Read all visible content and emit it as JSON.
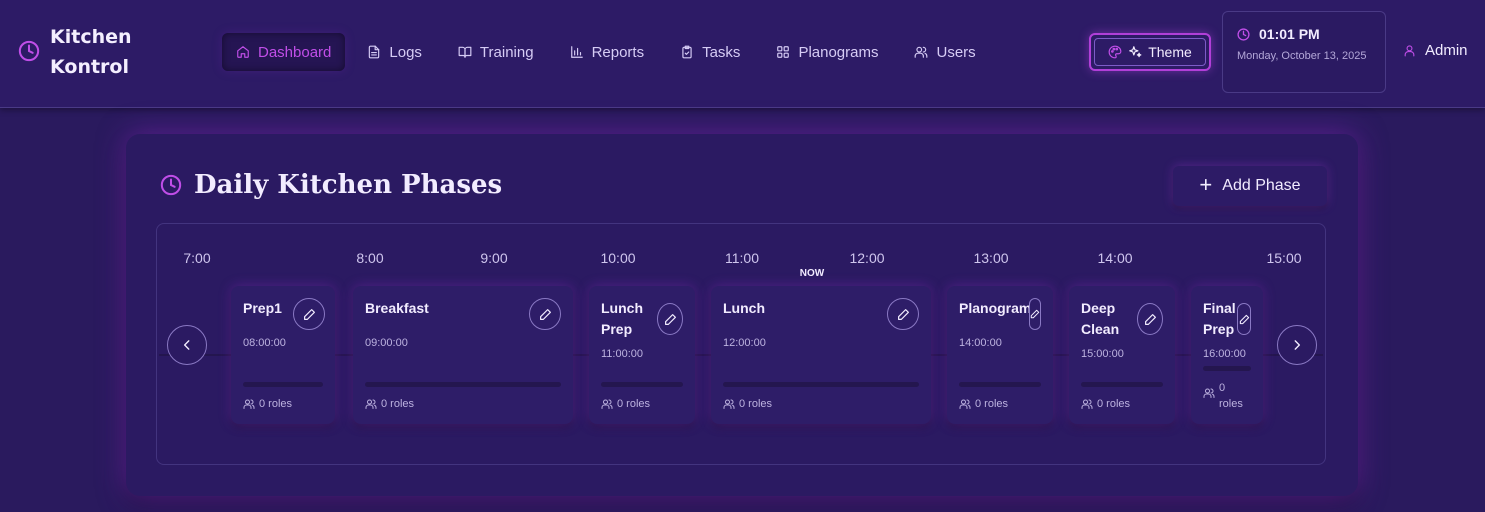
{
  "app": {
    "title": "Kitchen Kontrol"
  },
  "nav": {
    "items": [
      {
        "label": "Dashboard",
        "icon": "home-icon",
        "active": true
      },
      {
        "label": "Logs",
        "icon": "file-text-icon"
      },
      {
        "label": "Training",
        "icon": "book-open-icon"
      },
      {
        "label": "Reports",
        "icon": "bar-chart-icon"
      },
      {
        "label": "Tasks",
        "icon": "clipboard-check-icon"
      },
      {
        "label": "Planograms",
        "icon": "grid-icon"
      },
      {
        "label": "Users",
        "icon": "users-icon"
      }
    ],
    "theme_label": "Theme"
  },
  "clock": {
    "time": "01:01 PM",
    "date": "Monday, October 13, 2025"
  },
  "user": {
    "name": "Admin"
  },
  "colors": {
    "accent": "#c04ee8",
    "background": "#2a1a5e",
    "card": "#2b1a62"
  },
  "main": {
    "title": "Daily Kitchen Phases",
    "add_phase_label": "Add Phase",
    "timeline": {
      "hours": [
        "7:00",
        "8:00",
        "9:00",
        "10:00",
        "11:00",
        "12:00",
        "13:00",
        "14:00",
        "15:00"
      ],
      "now_label": "NOW",
      "phases": [
        {
          "name": "Prep1",
          "time": "08:00:00",
          "roles": "0 roles"
        },
        {
          "name": "Breakfast",
          "time": "09:00:00",
          "roles": "0 roles"
        },
        {
          "name": "Lunch Prep",
          "time": "11:00:00",
          "roles": "0 roles"
        },
        {
          "name": "Lunch",
          "time": "12:00:00",
          "roles": "0 roles"
        },
        {
          "name": "Planogram",
          "time": "14:00:00",
          "roles": "0 roles"
        },
        {
          "name": "Deep Clean",
          "time": "15:00:00",
          "roles": "0 roles"
        },
        {
          "name": "Final Prep",
          "time": "16:00:00",
          "roles": "0 roles"
        }
      ]
    }
  }
}
